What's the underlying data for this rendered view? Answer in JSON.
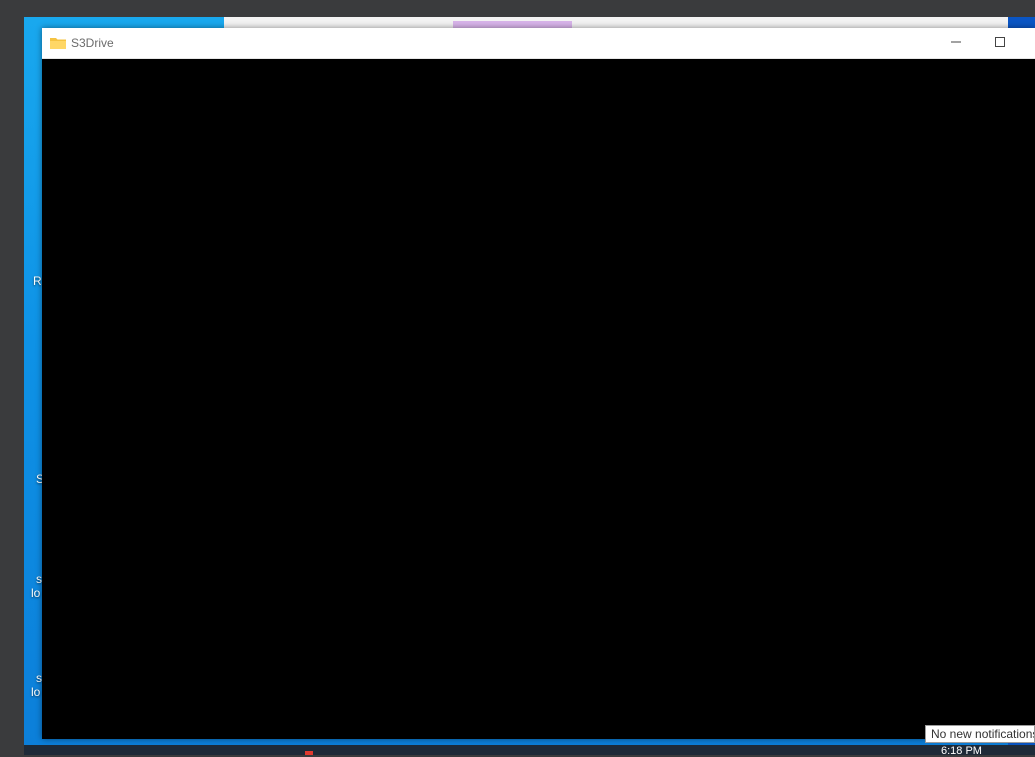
{
  "window": {
    "title": "S3Drive",
    "controls": {
      "minimize_icon": "minimize-icon",
      "maximize_icon": "maximize-icon"
    }
  },
  "desktop": {
    "icon_fragments": [
      {
        "text": "R"
      },
      {
        "text": "S"
      },
      {
        "text": "s"
      },
      {
        "text": "lo"
      },
      {
        "text": "s"
      },
      {
        "text": "lo"
      }
    ]
  },
  "taskbar": {
    "clock_time": "6:18 PM"
  },
  "notification": {
    "text": "No new notifications"
  },
  "colors": {
    "desktop_blue": "#0e92e6",
    "window_bg": "#000000",
    "titlebar_bg": "#ffffff",
    "folder_icon": "#f5c342"
  }
}
